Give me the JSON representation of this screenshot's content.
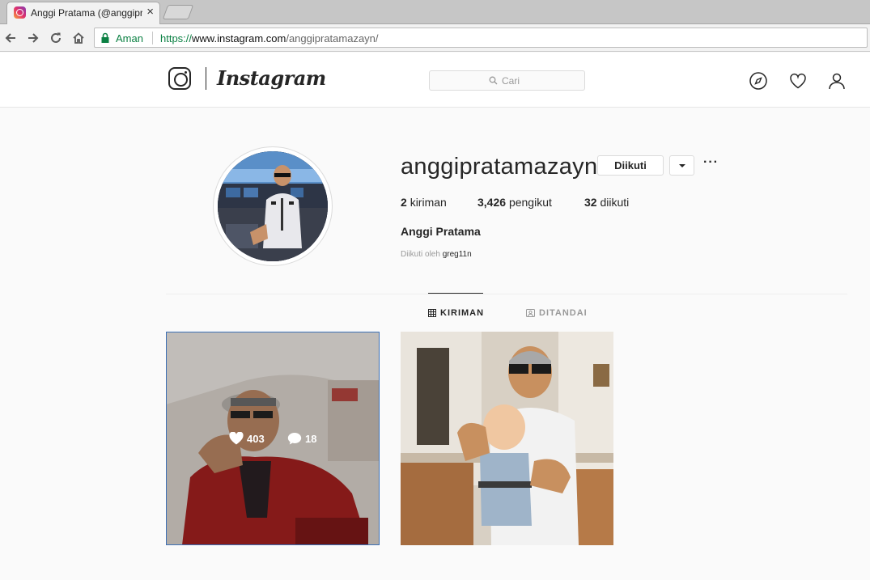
{
  "browser": {
    "tab_title": "Anggi Pratama (@anggipratamazayn)",
    "tab_close": "×",
    "security_label": "Aman",
    "url": {
      "scheme": "https://",
      "host": "www.instagram.com",
      "path": "/anggipratamazayn/"
    }
  },
  "header": {
    "wordmark": "Instagram",
    "search_placeholder": "Cari",
    "icons": [
      "compass-icon",
      "heart-icon",
      "profile-icon"
    ]
  },
  "profile": {
    "username": "anggipratamazayn",
    "follow_button": "Diikuti",
    "more_label": "···",
    "stats": {
      "posts_count": "2",
      "posts_label": "kiriman",
      "followers_count": "3,426",
      "followers_label": "pengikut",
      "following_count": "32",
      "following_label": "diikuti"
    },
    "full_name": "Anggi Pratama",
    "followed_by_prefix": "Diikuti oleh",
    "followed_by_user": "greg11n"
  },
  "tabs": [
    {
      "label": "KIRIMAN",
      "icon": "grid-icon",
      "active": true
    },
    {
      "label": "DITANDAI",
      "icon": "tagged-icon",
      "active": false
    }
  ],
  "posts": [
    {
      "likes": "403",
      "comments": "18",
      "hovered": true
    },
    {
      "hovered": false
    }
  ]
}
